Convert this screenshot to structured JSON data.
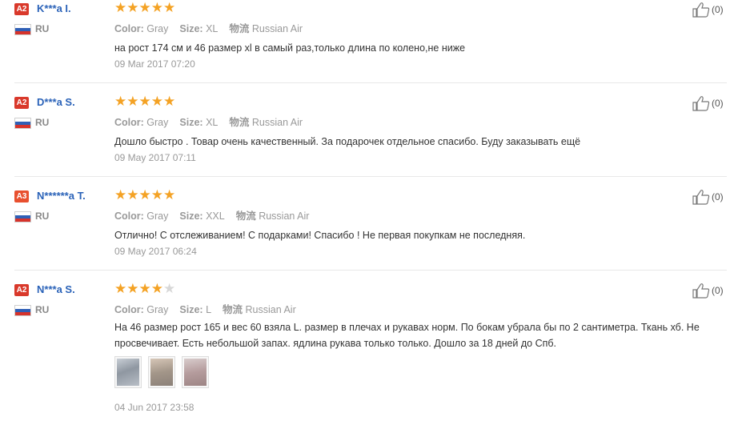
{
  "labels": {
    "color": "Color:",
    "size": "Size:",
    "shipping": "物流"
  },
  "reviews": [
    {
      "badge": "A2",
      "name": "K***a I.",
      "country": "RU",
      "rating": 5,
      "color": "Gray",
      "size": "XL",
      "shipping": "Russian Air",
      "text": "на рост 174 см и 46 размер xl в самый раз,только длина по колено,не ниже",
      "date": "09 Mar 2017 07:20",
      "likes": "(0)"
    },
    {
      "badge": "A2",
      "name": "D***a S.",
      "country": "RU",
      "rating": 5,
      "color": "Gray",
      "size": "XL",
      "shipping": "Russian Air",
      "text": "Дошло быстро . Товар очень качественный. За подарочек отдельное спасибо. Буду заказывать ещё",
      "date": "09 May 2017 07:11",
      "likes": "(0)"
    },
    {
      "badge": "A3",
      "name": "N******a T.",
      "country": "RU",
      "rating": 5,
      "color": "Gray",
      "size": "XXL",
      "shipping": "Russian Air",
      "text": "Отлично! С отслеживанием! С подарками! Спасибо ! Не первая покупкам не последняя.",
      "date": "09 May 2017 06:24",
      "likes": "(0)"
    },
    {
      "badge": "A2",
      "name": "N***a S.",
      "country": "RU",
      "rating": 4,
      "color": "Gray",
      "size": "L",
      "shipping": "Russian Air",
      "text": "На 46 размер рост 165 и вес 60 взяла L. размер в плечах и рукавах норм. По бокам убрала бы по 2 сантиметра. Ткань хб. Не просвечивает. Есть небольшой запах. ядлина рукава только только. Дошло за 18 дней до Спб.",
      "date": "04 Jun 2017 23:58",
      "likes": "(0)"
    }
  ],
  "icons": {
    "like": "thumbs-up-icon",
    "flag": "russia-flag-icon",
    "star": "star-icon"
  },
  "colors": {
    "star": "#f4a224",
    "name": "#2a62b8",
    "badge": "#d9392b"
  }
}
